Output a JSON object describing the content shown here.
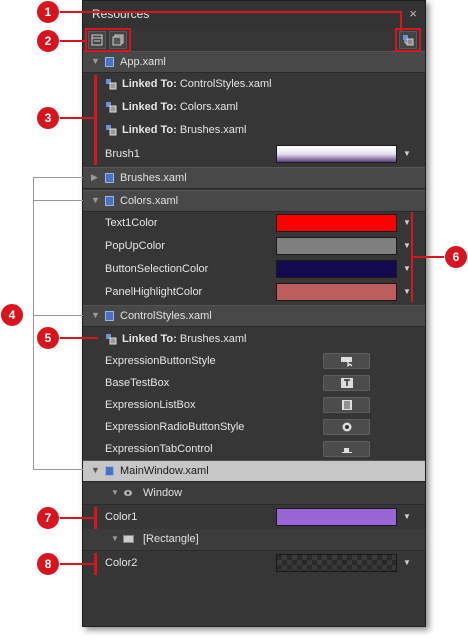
{
  "panel": {
    "title": "Resources",
    "close_glyph": "×"
  },
  "toolbar": {
    "icons": [
      "show-all-icon",
      "linked-view-icon",
      "add-link-icon"
    ]
  },
  "files": [
    {
      "name": "App.xaml",
      "expanded": true
    },
    {
      "name": "Brushes.xaml",
      "expanded": false
    },
    {
      "name": "Colors.xaml",
      "expanded": true
    },
    {
      "name": "ControlStyles.xaml",
      "expanded": true
    },
    {
      "name": "MainWindow.xaml",
      "expanded": true,
      "selected": true
    }
  ],
  "app": {
    "links": [
      {
        "prefix": "Linked To:",
        "target": "ControlStyles.xaml"
      },
      {
        "prefix": "Linked To:",
        "target": "Colors.xaml"
      },
      {
        "prefix": "Linked To:",
        "target": "Brushes.xaml"
      }
    ],
    "brush_label": "Brush1"
  },
  "colors": {
    "items": [
      {
        "label": "Text1Color",
        "color": "#ff0000"
      },
      {
        "label": "PopUpColor",
        "color": "#7f7f7f"
      },
      {
        "label": "ButtonSelectionColor",
        "color": "#13094f"
      },
      {
        "label": "PanelHighlightColor",
        "color": "#bd5d5d"
      }
    ]
  },
  "controlstyles": {
    "link": {
      "prefix": "Linked To:",
      "target": "Brushes.xaml"
    },
    "styles": [
      {
        "label": "ExpressionButtonStyle",
        "icon": "button-style-icon"
      },
      {
        "label": "BaseTestBox",
        "icon": "textbox-style-icon"
      },
      {
        "label": "ExpressionListBox",
        "icon": "listbox-style-icon"
      },
      {
        "label": "ExpressionRadioButtonStyle",
        "icon": "radio-style-icon"
      },
      {
        "label": "ExpressionTabControl",
        "icon": "tab-style-icon"
      }
    ]
  },
  "mainwindow": {
    "window_label": "Window",
    "color1_label": "Color1",
    "color1": "#9966d6",
    "rect_label": "[Rectangle]",
    "color2_label": "Color2"
  },
  "callouts": [
    "1",
    "2",
    "3",
    "4",
    "5",
    "6",
    "7",
    "8"
  ],
  "accent": "#d8151f"
}
